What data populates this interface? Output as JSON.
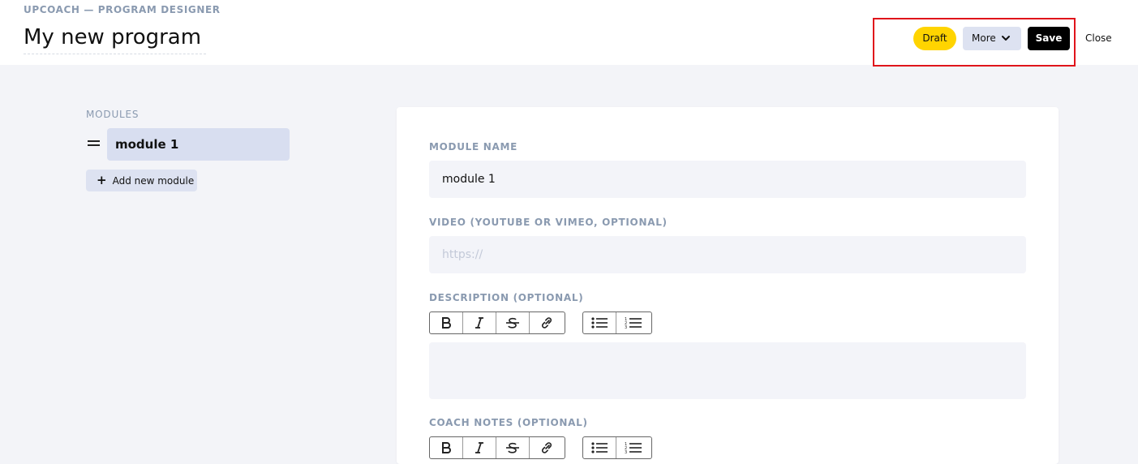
{
  "app": {
    "label": "UPCOACH — PROGRAM DESIGNER",
    "program_title": "My new program"
  },
  "header_actions": {
    "status": "Draft",
    "more_label": "More",
    "save_label": "Save",
    "close_label": "Close"
  },
  "colors": {
    "draft_badge": "#ffd400",
    "save_button": "#000000",
    "highlight": "#e0141b",
    "accent_soft": "#dde2f1"
  },
  "sidebar": {
    "heading": "MODULES",
    "modules": [
      {
        "label": "module 1"
      }
    ],
    "add_label": "Add new module"
  },
  "form": {
    "module_name_label": "MODULE NAME",
    "module_name_value": "module 1",
    "video_label": "VIDEO (YOUTUBE OR VIMEO, OPTIONAL)",
    "video_placeholder": "https://",
    "description_label": "DESCRIPTION (OPTIONAL)",
    "coach_notes_label": "COACH NOTES (OPTIONAL)",
    "toolbar_icons": [
      "bold-icon",
      "italic-icon",
      "strikethrough-icon",
      "link-icon",
      "bulleted-list-icon",
      "numbered-list-icon"
    ]
  }
}
